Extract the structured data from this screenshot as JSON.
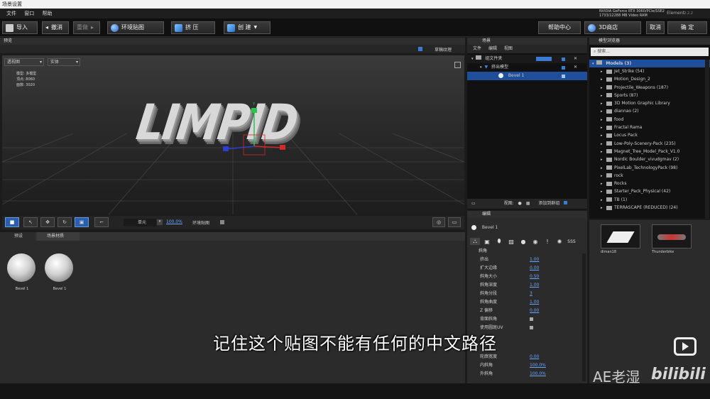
{
  "window": {
    "title": "场景设置"
  },
  "menu": [
    "文件",
    "窗口",
    "帮助"
  ],
  "gpu_line1": "NVIDIA GeForce RTX 3060/PCIe/SSE2",
  "gpu_line2": "1733/12288 MB Video RAM",
  "app_name": "Element",
  "app_version": "2.2.2",
  "toolbar": {
    "import": "导入",
    "undo": "撤消",
    "redo": "重做",
    "env_map": "环境贴图",
    "extrude": "挤 压",
    "create": "创 建",
    "help": "帮助中心",
    "store": "3D商店",
    "cancel": "取消",
    "ok": "确 定"
  },
  "preview": {
    "tab": "预览",
    "draft_label": "草稿纹理",
    "view_select": "透视图",
    "shade_select": "实体",
    "stats": [
      {
        "k": "模型:",
        "v": "多模型"
      },
      {
        "k": "顶点:",
        "v": "8060"
      },
      {
        "k": "面数:",
        "v": "3020"
      }
    ],
    "axis_y": "Y",
    "logo_text": "LIMPID",
    "bottom_select": "单元",
    "zoom": "100.0%",
    "env_label": "环境贴图"
  },
  "presets": {
    "tabs": [
      "预设",
      "场景材质"
    ],
    "items": [
      {
        "label": "Bevel 1"
      },
      {
        "label": "Bevel 1"
      }
    ]
  },
  "scene": {
    "title": "场景",
    "menu": [
      "文件",
      "编辑",
      "视图"
    ],
    "tree": [
      {
        "label": "组文件夹",
        "indent": 0
      },
      {
        "label": "挤出模型",
        "indent": 1
      },
      {
        "label": "Bevel 1",
        "indent": 2,
        "selected": true
      }
    ],
    "footer_view": "视图:",
    "footer_add": "添加到群组"
  },
  "edit": {
    "title": "编辑",
    "material_name": "Bevel 1",
    "section": "斜角",
    "props": [
      {
        "label": "挤出",
        "value": "1.00"
      },
      {
        "label": "扩大边缘",
        "value": "0.00"
      },
      {
        "label": "斜角大小",
        "value": "0.50"
      },
      {
        "label": "斜角深度",
        "value": "1.00"
      },
      {
        "label": "斜角分段",
        "value": "3"
      },
      {
        "label": "斜角曲度",
        "value": "1.00"
      },
      {
        "label": "Z 偏移",
        "value": "0.00"
      },
      {
        "label": "背面斜角",
        "value": ""
      },
      {
        "label": "使用圆斑UV",
        "value": ""
      }
    ],
    "props2": [
      {
        "label": "轮廓宽度",
        "value": "0.00"
      },
      {
        "label": "内斜角",
        "value": "100.0%"
      },
      {
        "label": "外斜角",
        "value": "100.0%"
      }
    ]
  },
  "browser": {
    "title": "模型浏览器",
    "search_placeholder": "搜索...",
    "root": "Models (3)",
    "items": [
      "Jet_Strike (54)",
      "Motion_Design_2",
      "Projectile_Weapons (187)",
      "Sports (87)",
      "3D Motion Graphic Library",
      "diannao (2)",
      "food",
      "Fractal Rama",
      "Locus Pack",
      "Low-Poly-Scenery-Pack (235)",
      "Magnet_Tree_Model_Pack_V1.0",
      "Nordic Boulder_vivudgmav (2)",
      "PixelLab_TechnologyPack (98)",
      "rock",
      "Rocks",
      "Starter_Pack_Physical (42)",
      "TB (1)",
      "TERRASCAPE (REDUCED) (24)"
    ],
    "thumbs": [
      {
        "label": "diman18"
      },
      {
        "label": "Thunderbike"
      }
    ]
  },
  "subtitle": "记住这个贴图不能有任何的中文路径",
  "watermark": "AE老湿",
  "watermark2": "bilibili",
  "colors": {
    "accent": "#2a5fb0",
    "selected_row": "#1f4f9a",
    "link": "#6aa4ff"
  }
}
